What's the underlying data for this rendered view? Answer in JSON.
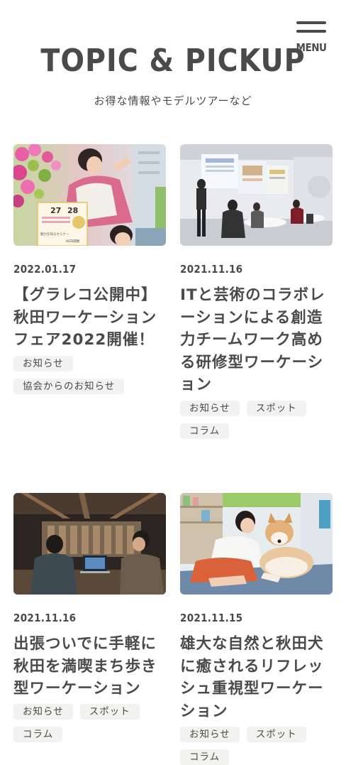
{
  "header": {
    "menu_label": "MENU",
    "title": "TOPIC & PICKUP",
    "subtitle": "お得な情報やモデルツアーなど"
  },
  "posts": [
    {
      "date": "2022.01.17",
      "title": "【グラレコ公開中】\n秋田ワーケーション\nフェア2022開催！",
      "tags": [
        "お知らせ",
        "協会からのお知らせ"
      ],
      "image_text": {
        "date_start": "27",
        "date_end": "28",
        "feature": "魅力を知るセミナー",
        "web": "WEB開催"
      }
    },
    {
      "date": "2021.11.16",
      "title": "ITと芸術のコラボレ\nーションによる創造\n力チームワーク高め\nる研修型ワーケーシ\nョン",
      "tags": [
        "お知らせ",
        "スポット",
        "コラム"
      ]
    },
    {
      "date": "2021.11.16",
      "title": "出張ついでに手軽に\n秋田を満喫まち歩き\n型ワーケーション",
      "tags": [
        "お知らせ",
        "スポット",
        "コラム"
      ]
    },
    {
      "date": "2021.11.15",
      "title": "雄大な自然と秋田犬\nに癒されるリフレッ\nシュ重視型ワーケー\nション",
      "tags": [
        "お知らせ",
        "スポット",
        "コラム"
      ]
    }
  ]
}
